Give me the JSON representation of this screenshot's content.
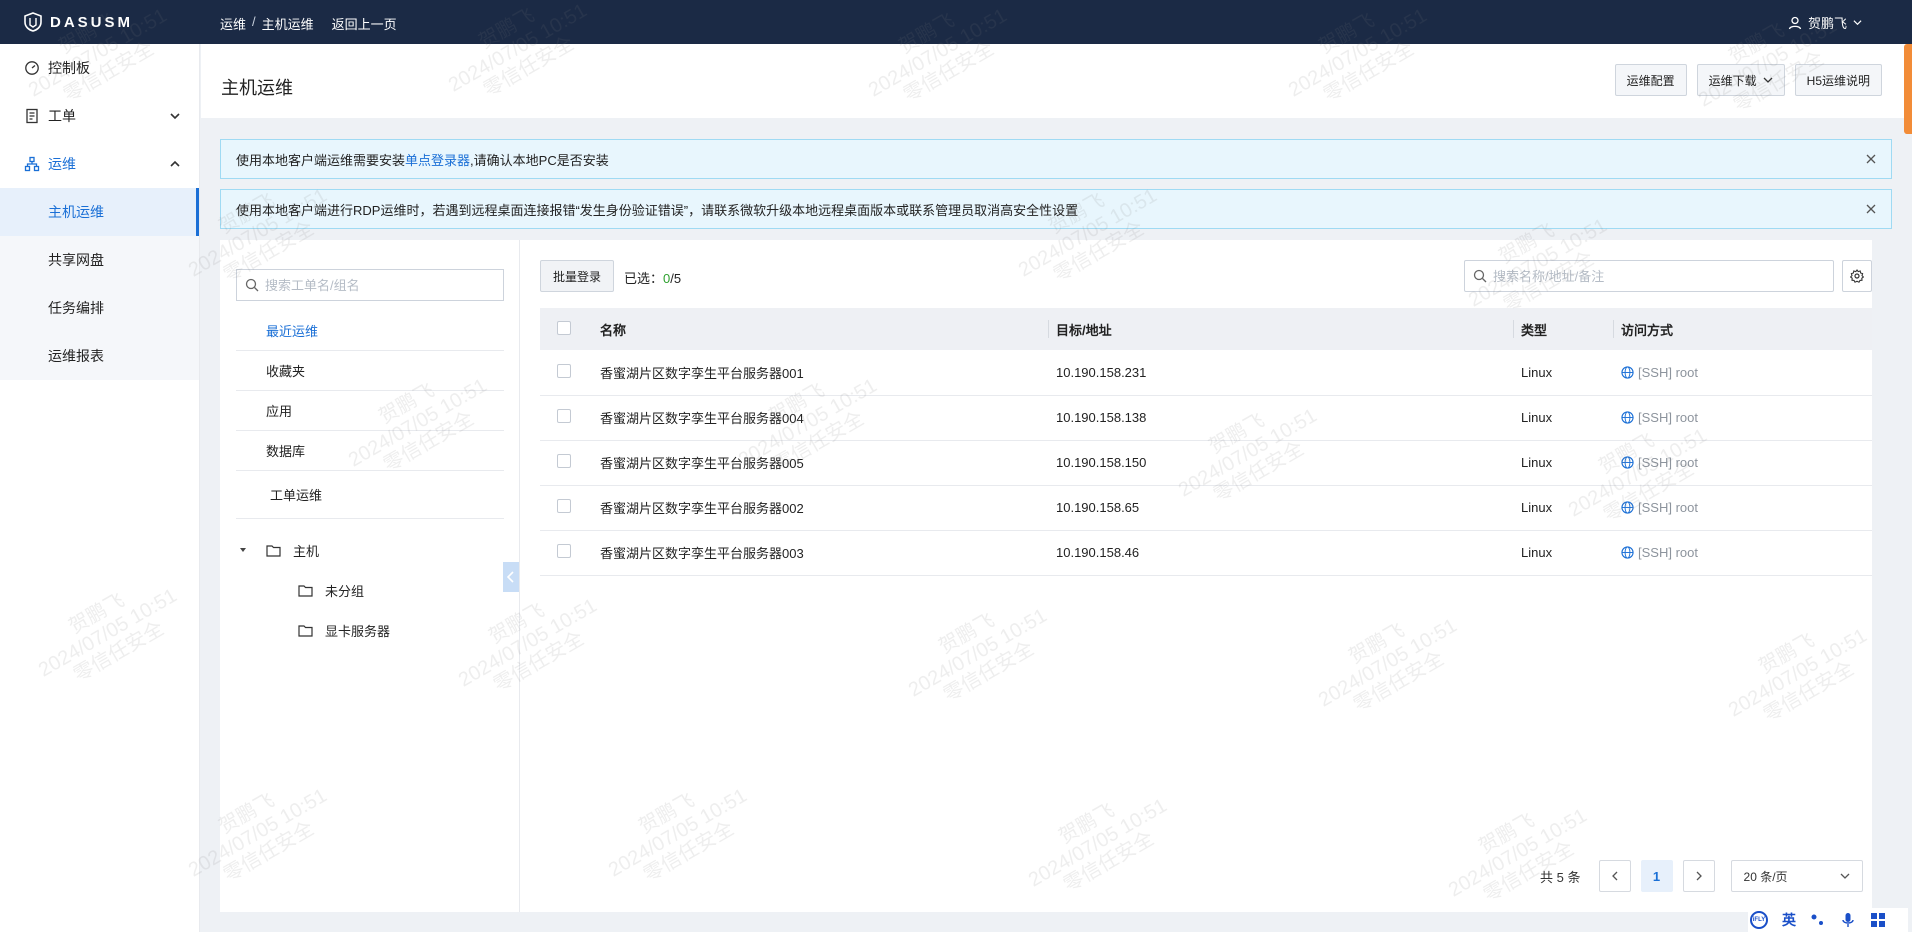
{
  "topbar": {
    "brand": "DASUSM",
    "breadcrumb": [
      "运维",
      "主机运维"
    ],
    "back_label": "返回上一页",
    "user_name": "贺鹏飞"
  },
  "sidebar": {
    "items": [
      {
        "label": "控制板",
        "icon": "dashboard-icon"
      },
      {
        "label": "工单",
        "icon": "ticket-icon"
      },
      {
        "label": "运维",
        "icon": "ops-icon"
      }
    ],
    "sub_items": [
      {
        "label": "主机运维",
        "active": true
      },
      {
        "label": "共享网盘",
        "active": false
      },
      {
        "label": "任务编排",
        "active": false
      },
      {
        "label": "运维报表",
        "active": false
      }
    ]
  },
  "header": {
    "title": "主机运维",
    "buttons": {
      "config": "运维配置",
      "download": "运维下载",
      "h5_help": "H5运维说明"
    }
  },
  "alerts": {
    "one_prefix": "使用本地客户端运维需要安装",
    "one_link": "单点登录器",
    "one_suffix": ",请确认本地PC是否安装",
    "two": "使用本地客户端进行RDP运维时，若遇到远程桌面连接报错“发生身份验证错误”，请联系微软升级本地远程桌面版本或联系管理员取消高安全性设置"
  },
  "left_panel": {
    "search_placeholder": "搜索工单名/组名",
    "categories": [
      "最近运维",
      "收藏夹",
      "应用",
      "数据库"
    ],
    "ticket_ops": "工单运维",
    "tree": {
      "root": "主机",
      "children": [
        "未分组",
        "显卡服务器"
      ]
    }
  },
  "toolbar": {
    "batch_login": "批量登录",
    "selected_label": "已选：",
    "selected_count": "0",
    "selected_total": "/5",
    "search_placeholder": "搜索名称/地址/备注"
  },
  "table": {
    "headers": {
      "name": "名称",
      "addr": "目标/地址",
      "type": "类型",
      "access": "访问方式"
    },
    "rows": [
      {
        "name": "香蜜湖片区数字孪生平台服务器001",
        "addr": "10.190.158.231",
        "type": "Linux",
        "access": "[SSH] root"
      },
      {
        "name": "香蜜湖片区数字孪生平台服务器004",
        "addr": "10.190.158.138",
        "type": "Linux",
        "access": "[SSH] root"
      },
      {
        "name": "香蜜湖片区数字孪生平台服务器005",
        "addr": "10.190.158.150",
        "type": "Linux",
        "access": "[SSH] root"
      },
      {
        "name": "香蜜湖片区数字孪生平台服务器002",
        "addr": "10.190.158.65",
        "type": "Linux",
        "access": "[SSH] root"
      },
      {
        "name": "香蜜湖片区数字孪生平台服务器003",
        "addr": "10.190.158.46",
        "type": "Linux",
        "access": "[SSH] root"
      }
    ]
  },
  "pagination": {
    "total_prefix": "共",
    "total": "5",
    "total_suffix": "条",
    "current_page": "1",
    "page_size": "20 条/页"
  },
  "ime": {
    "lang": "英",
    "badge": "iFLY"
  },
  "watermark": {
    "name": "贺鹏飞",
    "time": "2024/07/05 10:51",
    "org": "零信任安全"
  },
  "colors": {
    "topbar": "#1b2a45",
    "accent": "#1a6fd6",
    "alert_bg": "#e8f6fd",
    "selected_count": "#2fa02f"
  }
}
